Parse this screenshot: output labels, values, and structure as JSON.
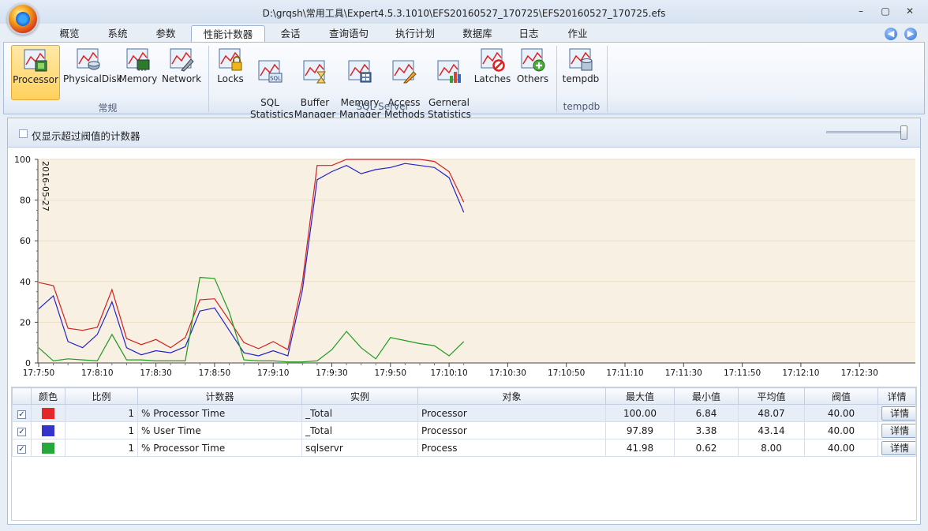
{
  "window": {
    "title": "D:\\grqsh\\常用工具\\Expert4.5.3.1010\\EFS20160527_170725\\EFS20160527_170725.efs",
    "min": "–",
    "max": "▢",
    "close": "✕"
  },
  "tabs": [
    "概览",
    "系统",
    "参数",
    "性能计数器",
    "会话",
    "查询语句",
    "执行计划",
    "数据库",
    "日志",
    "作业"
  ],
  "active_tab": "性能计数器",
  "nav": {
    "back": "◀",
    "forward": "▶"
  },
  "ribbon": {
    "groups": [
      {
        "label": "常规",
        "buttons": [
          "Processor",
          "PhysicalDisk",
          "Memory",
          "Network"
        ]
      },
      {
        "label": "SQL Server",
        "buttons": [
          "Locks",
          "SQL\nStatistics",
          "Buffer\nManager",
          "Memory\nManager",
          "Access\nMethods",
          "Gerneral\nStatistics",
          "Latches",
          "Others"
        ]
      },
      {
        "label": "tempdb",
        "buttons": [
          "tempdb"
        ]
      }
    ],
    "selected": "Processor"
  },
  "filter": {
    "label": "仅显示超过阀值的计数器"
  },
  "colors": {
    "red": "#d32020",
    "blue": "#2323c8",
    "green": "#1e9a1e",
    "plot_bg": "#f8f1e3"
  },
  "chart_data": {
    "type": "line",
    "date_label": "2016-05-27",
    "ylim": [
      0,
      100
    ],
    "yticks": [
      0,
      20,
      40,
      60,
      80,
      100
    ],
    "x_ticks": [
      "17:7:50",
      "17:8:10",
      "17:8:30",
      "17:8:50",
      "17:9:10",
      "17:9:30",
      "17:9:50",
      "17:10:10",
      "17:10:30",
      "17:10:50",
      "17:11:10",
      "17:11:30",
      "17:11:50",
      "17:12:10",
      "17:12:30"
    ],
    "x_start": "17:7:50",
    "x_step_seconds": 5,
    "series": [
      {
        "color": "red",
        "values": [
          39.5,
          38,
          17,
          16,
          17.5,
          36,
          12,
          9,
          11.5,
          7.5,
          12.5,
          31,
          31.5,
          21,
          10,
          7,
          10.5,
          6.5,
          40,
          97,
          97,
          100,
          100,
          100,
          100,
          100,
          100,
          99,
          94,
          79
        ]
      },
      {
        "color": "blue",
        "values": [
          26.5,
          33,
          10.5,
          7.5,
          14,
          30,
          7.5,
          4,
          6,
          5,
          8,
          25.5,
          27,
          16,
          5,
          3.5,
          6,
          3.5,
          36,
          90,
          94,
          97,
          93,
          95,
          96,
          98,
          97,
          96,
          91,
          74
        ]
      },
      {
        "color": "green",
        "values": [
          7.5,
          1,
          2,
          1.5,
          1,
          14,
          1.5,
          1.5,
          1,
          1,
          1,
          42,
          41.5,
          25,
          1.5,
          1,
          1,
          0.5,
          0.5,
          1,
          6.5,
          15.5,
          7.5,
          2,
          12.5,
          11,
          9.5,
          8.5,
          3.5,
          10.5
        ]
      }
    ]
  },
  "grid": {
    "headers": [
      "",
      "颜色",
      "比例",
      "计数器",
      "实例",
      "对象",
      "最大值",
      "最小值",
      "平均值",
      "阀值",
      "详情"
    ],
    "detail_label": "详情",
    "rows": [
      {
        "checked": "✓",
        "color": "#e42828",
        "scale": "1",
        "counter": "% Processor Time",
        "instance": "_Total",
        "object": "Processor",
        "max": "100.00",
        "min": "6.84",
        "avg": "48.07",
        "threshold": "40.00"
      },
      {
        "checked": "✓",
        "color": "#3434cc",
        "scale": "1",
        "counter": "% User Time",
        "instance": "_Total",
        "object": "Processor",
        "max": "97.89",
        "min": "3.38",
        "avg": "43.14",
        "threshold": "40.00"
      },
      {
        "checked": "✓",
        "color": "#27a83b",
        "scale": "1",
        "counter": "% Processor Time",
        "instance": "sqlservr",
        "object": "Process",
        "max": "41.98",
        "min": "0.62",
        "avg": "8.00",
        "threshold": "40.00"
      }
    ]
  }
}
